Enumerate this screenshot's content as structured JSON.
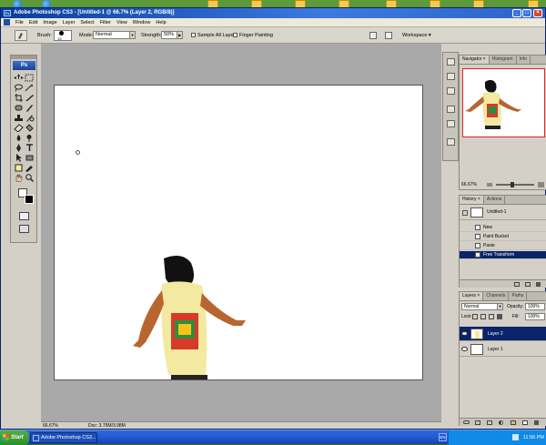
{
  "window": {
    "title": "Adobe Photoshop CS3 - [Untitled-1 @ 66.7% (Layer 2, RGB/8)]",
    "minimize": "_",
    "maximize": "□",
    "close": "×"
  },
  "menu": [
    "File",
    "Edit",
    "Image",
    "Layer",
    "Select",
    "Filter",
    "View",
    "Window",
    "Help"
  ],
  "options_bar": {
    "brush_label": "Brush:",
    "brush_size": "13",
    "mode_label": "Mode:",
    "mode_value": "Normal",
    "strength_label": "Strength:",
    "strength_value": "50%",
    "sample_all_layers": "Sample All Layers",
    "finger_painting": "Finger Painting",
    "workspace": "Workspace ▾"
  },
  "toolbox": {
    "logo": "Ps"
  },
  "status_bar": {
    "zoom": "66.67%",
    "doc": "Doc: 3.75M/3.98M"
  },
  "navigator": {
    "tabs": [
      "Navigator ×",
      "Histogram",
      "Info"
    ],
    "zoom": "66.67%"
  },
  "history": {
    "tabs": [
      "History ×",
      "Actions"
    ],
    "snapshot": "Untitled-1",
    "items": [
      "New",
      "Paint Bucket",
      "Paste",
      "Free Transform"
    ],
    "selected_index": 3
  },
  "layers": {
    "tabs": [
      "Layers ×",
      "Channels",
      "Paths"
    ],
    "blend_mode": "Normal",
    "opacity_label": "Opacity:",
    "opacity_value": "100%",
    "lock_label": "Lock:",
    "fill_label": "Fill:",
    "fill_value": "100%",
    "items": [
      "Layer 2",
      "Layer 1"
    ],
    "selected_index": 0
  },
  "taskbar": {
    "start_label": "Start",
    "task_label": "Adobe Photoshop CS3...",
    "language": "EN",
    "clock": "11:56 PM"
  },
  "colors": {
    "title_bar": "#0a3d9e",
    "selection": "#0a246a",
    "workspace_bg": "#a9a9a9",
    "shirt": "#f3e9a0"
  }
}
